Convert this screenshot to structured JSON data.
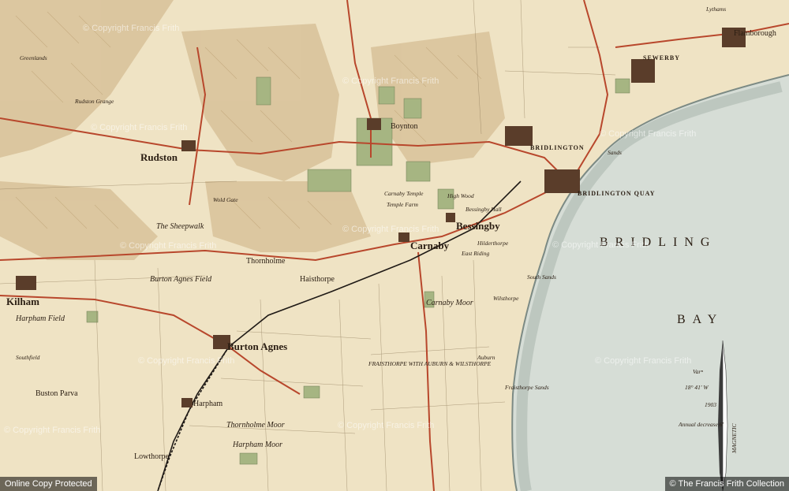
{
  "places": {
    "rudston": "Rudston",
    "kilham": "Kilham",
    "burton_agnes": "Burton Agnes",
    "carnaby": "Carnaby",
    "bessingby": "Bessingby",
    "bridlington": "BRIDLINGTON",
    "bridlington_quay": "BRIDLINGTON QUAY",
    "haisthorpe": "Haisthorpe",
    "thornholme": "Thornholme",
    "boynton": "Boynton",
    "harpham": "Harpham",
    "lowthorpe": "Lowthorpe",
    "flamborough": "Flamborough",
    "bridlington_bay_1": "BRIDLING",
    "bridlington_bay_2": "BAY",
    "burton_agnes_field": "Burton Agnes Field",
    "harpham_field": "Harpham Field",
    "carnaby_moor": "Carnaby Moor",
    "thornholme_moor": "Thornholme Moor",
    "harpham_moor": "Harpham Moor",
    "the_sheepwalk": "The Sheepwalk",
    "buston_parva": "Buston Parva",
    "sewerby": "SEWERBY",
    "fraisthorpe": "FRAISTHORPE WITH AUBURN & WILSTHORPE",
    "lythams": "Lythams",
    "greenlands": "Greenlands",
    "southfield": "Southfield",
    "auburn": "Auburn",
    "fraisthorpe_sands": "Fraisthorpe Sands",
    "wilsthorpe": "Wilsthorpe",
    "south_sands": "South Sands",
    "sands": "Sands",
    "carnaby_temple": "Carnaby Temple",
    "temple_farm": "Temple Farm",
    "hilderthorpe": "Hilderthorpe",
    "high_wood": "High Wood",
    "wold_gate": "Wold Gate",
    "bessingby_hall": "Bessingby Hall",
    "rudston_grange": "Rudston Grange",
    "east_riding": "East Riding"
  },
  "compass": {
    "var_label": "Varⁿ",
    "var_value": "18° 41' W",
    "year": "1903",
    "annual": "Annual decrease 6'",
    "magnetic": "MAGNETIC"
  },
  "watermarks": [
    "© Copyright Francis Frith",
    "© Copyright Francis Frith",
    "© Copyright Francis Frith",
    "© Copyright Francis Frith",
    "© Copyright Francis Frith",
    "© Copyright Francis Frith",
    "© Copyright Francis Frith",
    "© Copyright Francis Frith",
    "© Copyright Francis Frith",
    "© Copyright Francis Frith",
    "© Copyright Francis Frith"
  ],
  "footer": {
    "left": "Online Copy Protected",
    "right": "© The Francis Frith Collection"
  },
  "colors": {
    "paper": "#efe3c4",
    "sea": "#d8dfd9",
    "shore": "#b9c2ba",
    "hills": "#d6c09a",
    "woods": "#9caf78",
    "roads": "#b8462b",
    "rail": "#1f1a16"
  }
}
